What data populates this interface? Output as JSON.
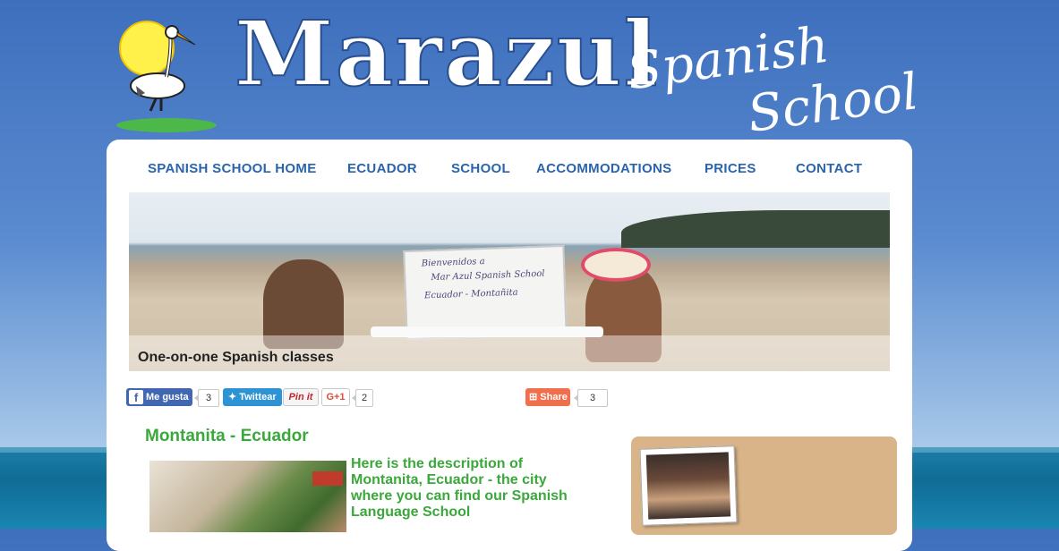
{
  "header": {
    "title": "Marazul",
    "subtitle_line1": "Spanish",
    "subtitle_line2": "School",
    "logo_icon": "stork-sun-logo-icon"
  },
  "nav": {
    "items": [
      {
        "label": "SPANISH SCHOOL HOME"
      },
      {
        "label": "ECUADOR"
      },
      {
        "label": "SCHOOL"
      },
      {
        "label": "ACCOMMODATIONS"
      },
      {
        "label": "PRICES"
      },
      {
        "label": "CONTACT"
      }
    ],
    "color": "#2a64ad"
  },
  "banner": {
    "caption": "One-on-one Spanish classes",
    "board_line1": "Bienvenidos a",
    "board_line2": "Mar Azul Spanish School",
    "board_line3": "Ecuador - Montañita"
  },
  "social": {
    "facebook_label": "Me gusta",
    "facebook_count": "3",
    "twitter_label": "Twittear",
    "pinterest_label": "Pin it",
    "gplus_label": "G+1",
    "gplus_count": "2",
    "share_label": "Share",
    "share_count": "3"
  },
  "content": {
    "heading": "Montanita - Ecuador",
    "description": "Here is the description of Montanita, Ecuador - the city where you can find our Spanish Language School",
    "accent_color": "#3aa83a"
  }
}
